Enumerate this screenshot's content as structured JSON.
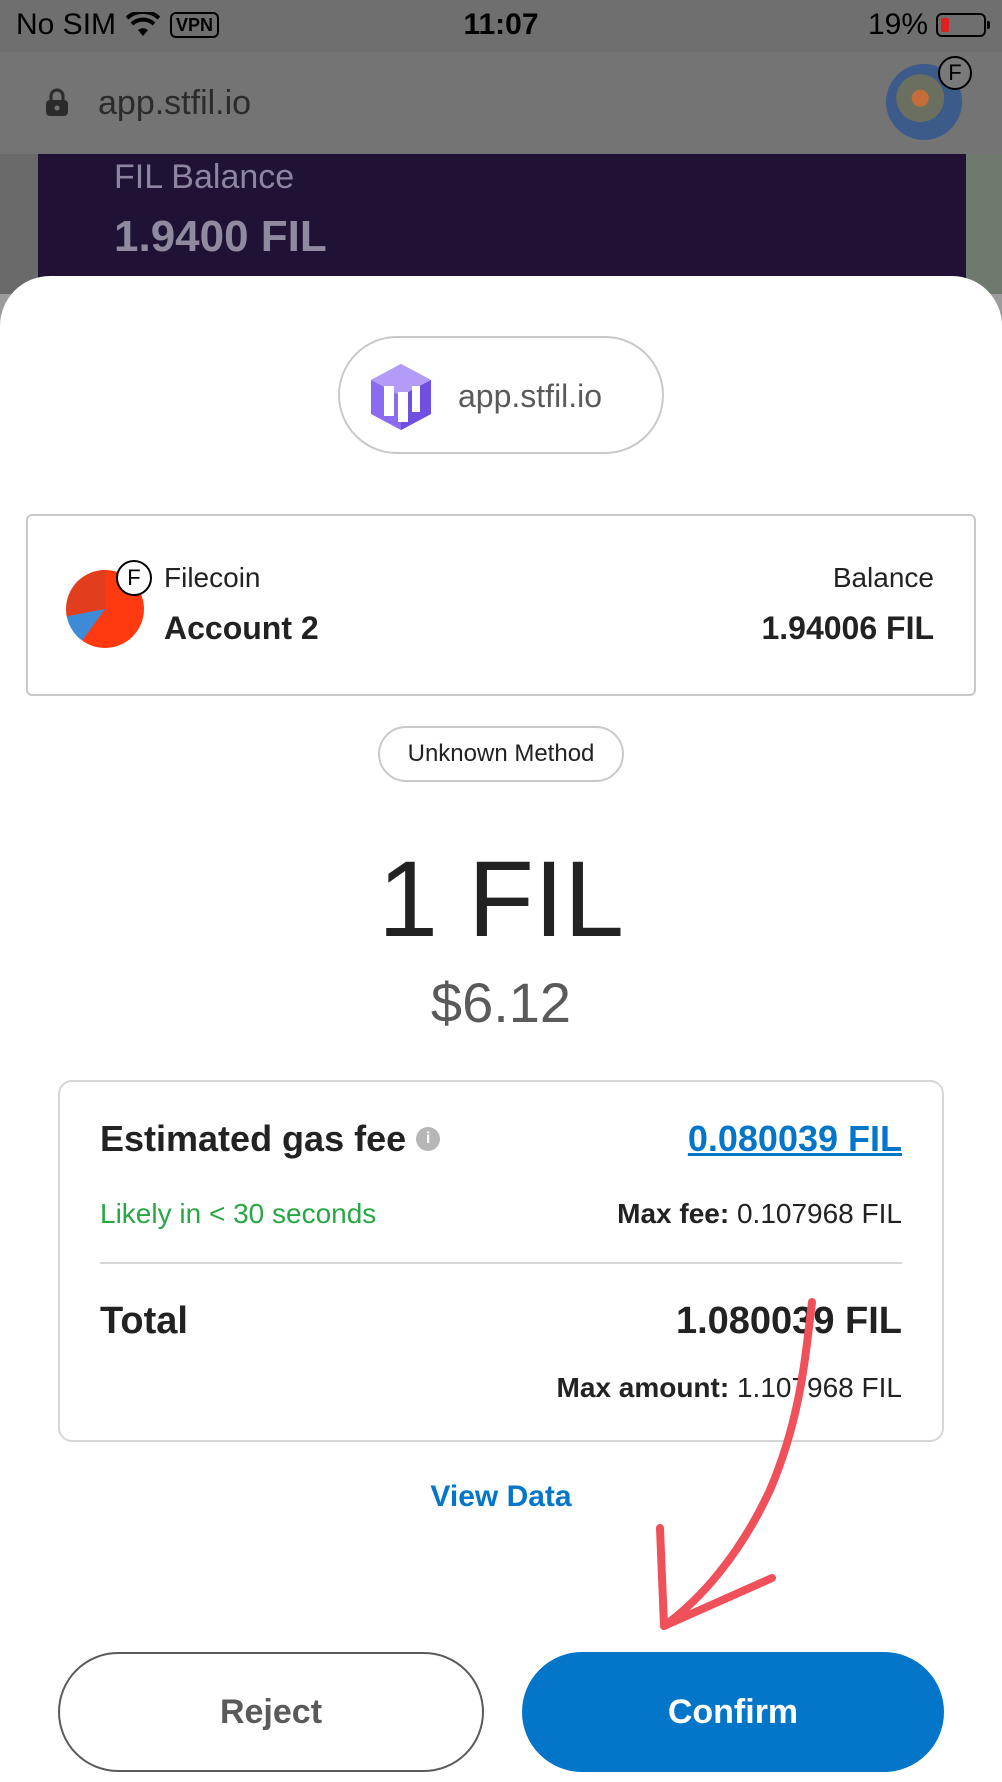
{
  "status_bar": {
    "carrier": "No SIM",
    "vpn": "VPN",
    "time": "11:07",
    "battery": "19%"
  },
  "browser": {
    "url": "app.stfil.io",
    "account_badge": "F"
  },
  "background_page": {
    "balance_label": "FIL Balance",
    "balance_value": "1.9400 FIL"
  },
  "modal": {
    "origin": "app.stfil.io",
    "account": {
      "badge": "F",
      "network": "Filecoin",
      "name": "Account 2",
      "balance_label": "Balance",
      "balance_value": "1.94006 FIL"
    },
    "method": "Unknown Method",
    "amount": "1 FIL",
    "fiat": "$6.12",
    "fee": {
      "label": "Estimated gas fee",
      "info_icon": "i",
      "value": "0.080039 FIL",
      "time": "Likely in < 30 seconds",
      "max_label": "Max fee:",
      "max_value": "0.107968 FIL"
    },
    "total": {
      "label": "Total",
      "value": "1.080039 FIL",
      "max_label": "Max amount:",
      "max_value": "1.107968 FIL"
    },
    "view_data": "View Data",
    "buttons": {
      "reject": "Reject",
      "confirm": "Confirm"
    }
  },
  "colors": {
    "accent": "#0376c9",
    "success": "#28a745",
    "annotation_arrow": "#f0505a"
  }
}
